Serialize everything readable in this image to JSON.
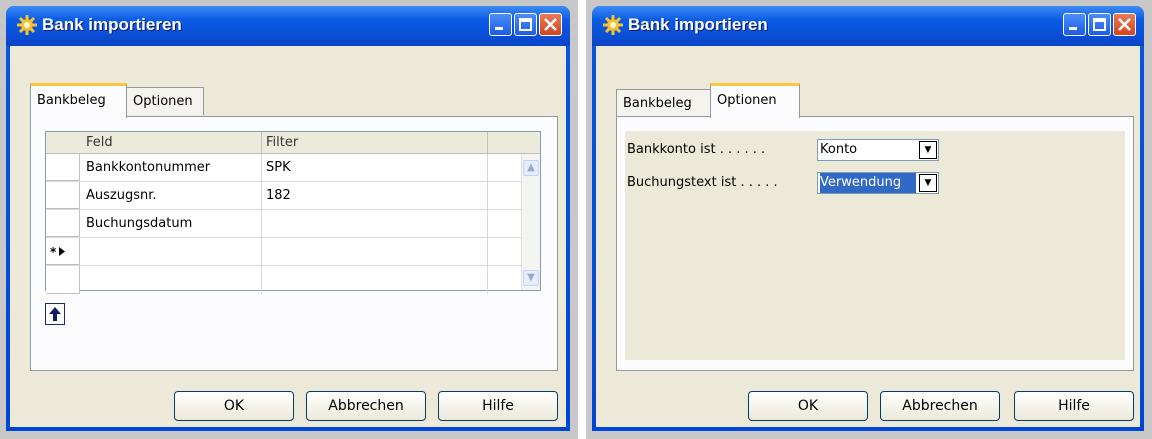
{
  "dialog_left": {
    "title": "Bank importieren",
    "tabs": [
      "Bankbeleg",
      "Optionen"
    ],
    "active_tab": 0,
    "grid": {
      "columns": [
        "Feld",
        "Filter"
      ],
      "rows": [
        {
          "feld": "Bankkontonummer",
          "filter": "SPK"
        },
        {
          "feld": "Auszugsnr.",
          "filter": "182"
        },
        {
          "feld": "Buchungsdatum",
          "filter": ""
        },
        {
          "feld": "",
          "filter": "",
          "new_row": true
        },
        {
          "feld": "",
          "filter": ""
        }
      ]
    },
    "buttons": {
      "ok": "OK",
      "cancel": "Abbrechen",
      "help": "Hilfe"
    }
  },
  "dialog_right": {
    "title": "Bank importieren",
    "tabs": [
      "Bankbeleg",
      "Optionen"
    ],
    "active_tab": 1,
    "fields": [
      {
        "label": "Bankkonto ist . . . . . .",
        "value": "Konto"
      },
      {
        "label": "Buchungstext ist . . . . .",
        "value": "Verwendung"
      }
    ],
    "buttons": {
      "ok": "OK",
      "cancel": "Abbrechen",
      "help": "Hilfe"
    }
  },
  "icons": {
    "app": "gear-icon",
    "minimize": "minimize-icon",
    "maximize": "maximize-icon",
    "close": "close-icon"
  },
  "colors": {
    "titlebar": "#0a5be4",
    "dialog_bg": "#ece9d8",
    "tab_accent": "#ffc83c",
    "close": "#d2441f"
  }
}
